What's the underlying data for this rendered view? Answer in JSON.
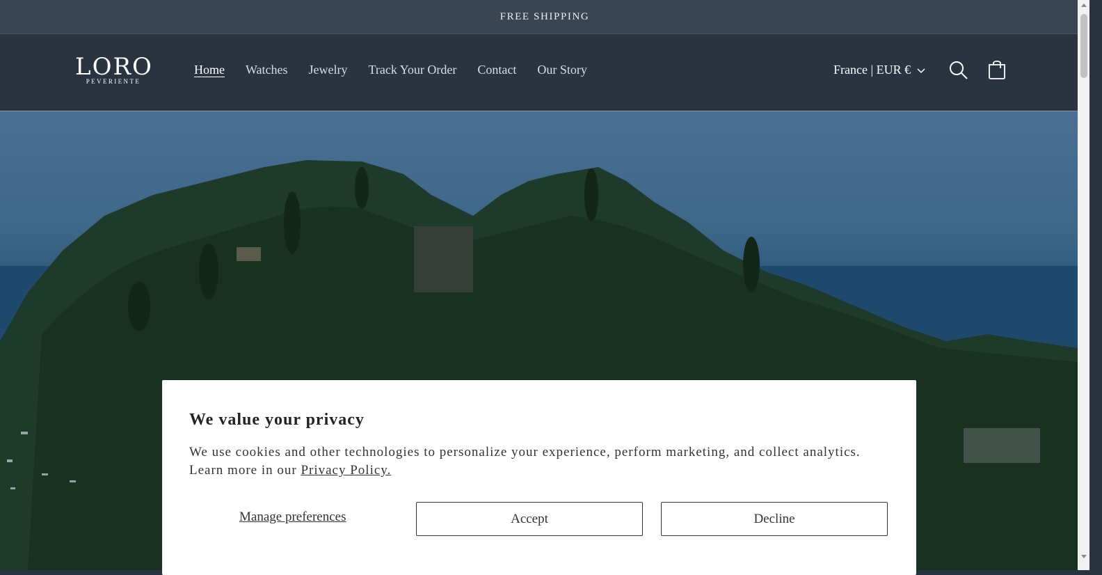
{
  "announcement": {
    "text": "FREE SHIPPING"
  },
  "header": {
    "logo": {
      "main": "LORO",
      "sub": "PEVERIENTE"
    },
    "nav": [
      {
        "label": "Home",
        "active": true
      },
      {
        "label": "Watches",
        "active": false
      },
      {
        "label": "Jewelry",
        "active": false
      },
      {
        "label": "Track Your Order",
        "active": false
      },
      {
        "label": "Contact",
        "active": false
      },
      {
        "label": "Our Story",
        "active": false
      }
    ],
    "locale": {
      "label": "France | EUR €"
    },
    "icons": {
      "search": "search-icon",
      "cart": "cart-icon",
      "chevron": "chevron-down-icon"
    }
  },
  "cookie_banner": {
    "title": "We value your privacy",
    "body": "We use cookies and other technologies to personalize your experience, perform marketing, and collect analytics. Learn more in our",
    "policy_link": "Privacy Policy.",
    "manage_label": "Manage preferences",
    "accept_label": "Accept",
    "decline_label": "Decline"
  },
  "colors": {
    "header_bg": "#2a3340",
    "announcement_bg": "#3a4553",
    "banner_bg": "#ffffff",
    "text_dark": "#333333"
  }
}
